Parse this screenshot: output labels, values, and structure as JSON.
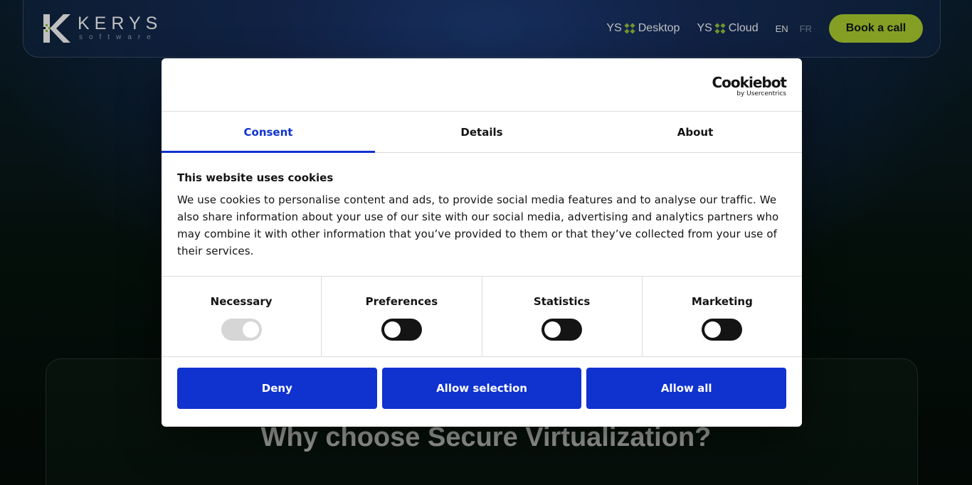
{
  "header": {
    "logo_word": "KERYS",
    "logo_sub": "software",
    "nav": [
      {
        "prefix": "YS",
        "label": "Desktop"
      },
      {
        "prefix": "YS",
        "label": "Cloud"
      }
    ],
    "lang_active": "EN",
    "lang_inactive": "FR",
    "cta_label": "Book a call"
  },
  "section": {
    "title": "Why choose Secure Virtualization?"
  },
  "cookie_dialog": {
    "brand": "Cookiebot",
    "brand_by": "by Usercentrics",
    "tabs": [
      "Consent",
      "Details",
      "About"
    ],
    "active_tab": "Consent",
    "heading": "This website uses cookies",
    "text": "We use cookies to personalise content and ads, to provide social media features and to analyse our traffic. We also share information about your use of our site with our social media, advertising and analytics partners who may combine it with other information that you’ve provided to them or that they’ve collected from your use of their services.",
    "toggles": [
      {
        "label": "Necessary",
        "state": "on-disabled"
      },
      {
        "label": "Preferences",
        "state": "off"
      },
      {
        "label": "Statistics",
        "state": "off"
      },
      {
        "label": "Marketing",
        "state": "off"
      }
    ],
    "buttons": {
      "deny": "Deny",
      "allow_selection": "Allow selection",
      "allow_all": "Allow all"
    }
  },
  "colors": {
    "accent_blue": "#1032cf",
    "cta_green": "#b2d432"
  }
}
